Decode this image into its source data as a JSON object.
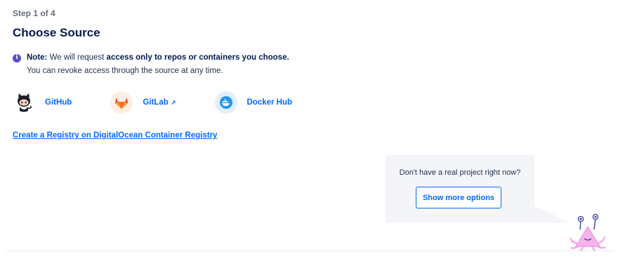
{
  "step": {
    "label": "Step 1 of 4"
  },
  "page_title": "Choose Source",
  "note": {
    "prefix": "Note:",
    "text_before": " We will request ",
    "emphasis": "access only to repos or containers you choose.",
    "line2": "You can revoke access through the source at any time."
  },
  "sources": {
    "github": "GitHub",
    "gitlab": "GitLab",
    "gitlab_external_indicator": "↗",
    "dockerhub": "Docker Hub"
  },
  "registry_link": "Create a Registry on DigitalOcean Container Registry",
  "promo": {
    "text": "Don't have a real project right now?",
    "button": "Show more options"
  },
  "colors": {
    "accent": "#0069ff",
    "heading": "#031b4e",
    "info_icon": "#5a4fcf",
    "promo_bg": "#f3f5f9",
    "gitlab_bg": "#fdeee3",
    "docker_bg": "#e2eefc"
  },
  "icons": {
    "info": "info-icon",
    "github": "github-logo-icon",
    "gitlab": "gitlab-logo-icon",
    "docker": "docker-logo-icon",
    "mascot": "sammy-mascot-icon"
  }
}
